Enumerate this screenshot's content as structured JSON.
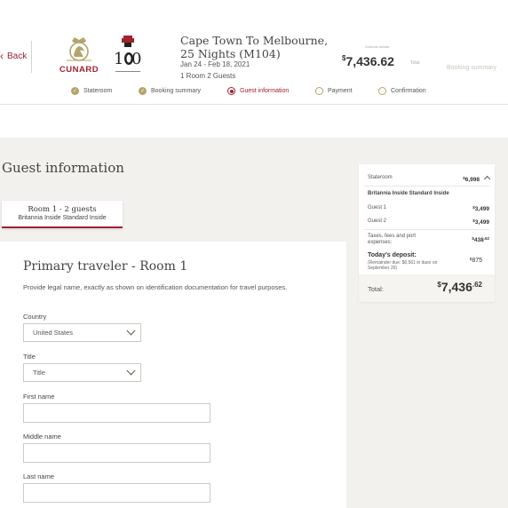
{
  "header": {
    "back_label": "Back",
    "brand_name": "CUNARD",
    "anniversary_mark": "180",
    "trip_title": "Cape Town To Melbourne, 25 Nights (M104)",
    "trip_dates": "Jan 24 - Feb 18, 2021",
    "trip_guests": "1 Room 2 Guests",
    "price_mini_label": "Subtotal details",
    "price_currency": "$",
    "price_amount": "7,436.62",
    "price_total_tag": "Total",
    "booking_summary_link": "Booking summary"
  },
  "steps": [
    {
      "label": "Stateroom",
      "state": "done"
    },
    {
      "label": "Booking summary",
      "state": "done"
    },
    {
      "label": "Guest information",
      "state": "current"
    },
    {
      "label": "Payment",
      "state": "todo"
    },
    {
      "label": "Confirmation",
      "state": "todo"
    }
  ],
  "main": {
    "section_title": "Guest information",
    "room_tab": {
      "title": "Room 1 - 2 guests",
      "subtitle": "Britannia Inside Standard Inside"
    },
    "form": {
      "title": "Primary traveler - Room 1",
      "description": "Provide legal name, exactly as shown on identification documentation for travel purposes.",
      "country_label": "Country",
      "country_value": "United States",
      "title_label": "Title",
      "title_value": "Title",
      "first_name_label": "First name",
      "first_name_value": "",
      "middle_name_label": "Middle name",
      "middle_name_value": "",
      "last_name_label": "Last name",
      "last_name_value": ""
    }
  },
  "summary": {
    "stateroom_label": "Stateroom",
    "stateroom_amount": "6,998",
    "room_type": "Britannia Inside Standard Inside",
    "guest1_label": "Guest 1",
    "guest1_amount": "3,499",
    "guest2_label": "Guest 2",
    "guest2_amount": "3,499",
    "taxes_label": "Taxes, fees and port expenses:",
    "taxes_amount": "438",
    "taxes_cents": ".62",
    "deposit_title": "Today's deposit:",
    "deposit_note": "(Remainder due: $6,561 in dues on September 26)",
    "deposit_amount": "875",
    "total_label": "Total:",
    "total_amount": "7,436",
    "total_cents": ".62",
    "currency": "$"
  },
  "colors": {
    "accent": "#a3202f",
    "gold": "#b5a46a",
    "panel_bg": "#f3f1ed"
  }
}
